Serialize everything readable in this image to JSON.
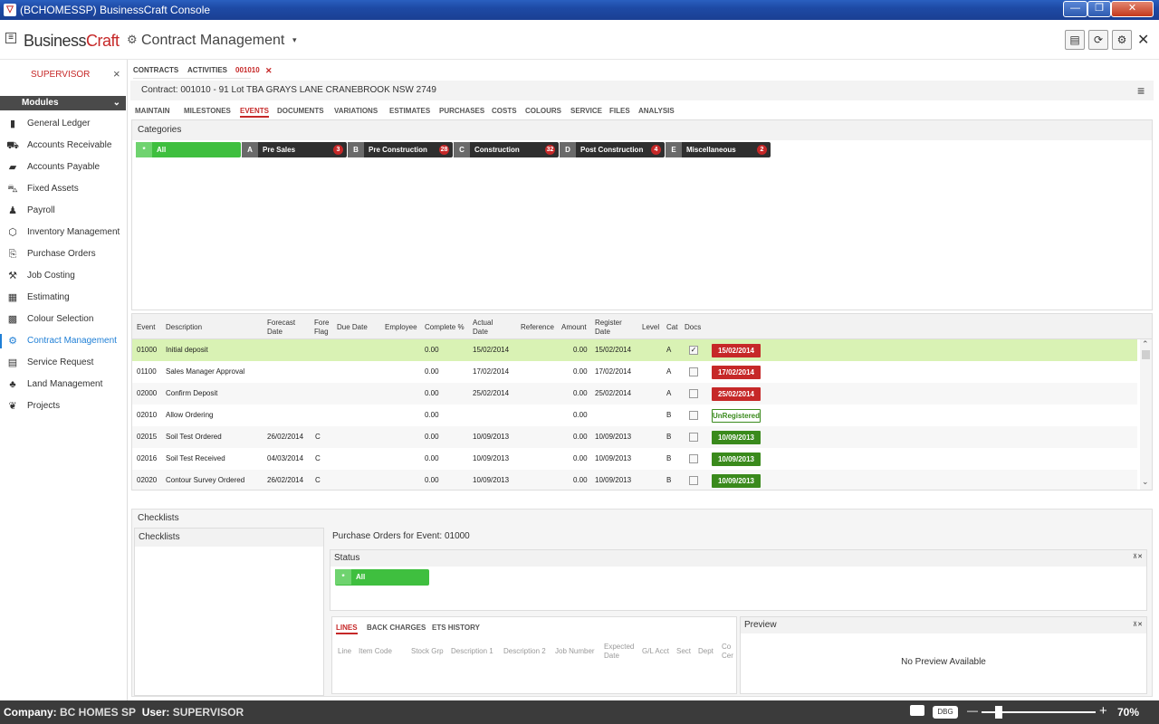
{
  "window": {
    "title": "(BCHOMESSP) BusinessCraft Console",
    "minimize": "—",
    "maximize": "❐",
    "close": "✕"
  },
  "header": {
    "menu_icon": "≡",
    "brand_a": "Business",
    "brand_b": "Craft",
    "title": "Contract Management",
    "close": "✕"
  },
  "sidebar": {
    "user": "SUPERVISOR",
    "close": "×",
    "modules_label": "Modules",
    "items": [
      {
        "label": "General Ledger",
        "icon": "book-icon"
      },
      {
        "label": "Accounts Receivable",
        "icon": "cart-icon"
      },
      {
        "label": "Accounts Payable",
        "icon": "folder-icon"
      },
      {
        "label": "Fixed Assets",
        "icon": "car-icon"
      },
      {
        "label": "Payroll",
        "icon": "people-icon"
      },
      {
        "label": "Inventory Management",
        "icon": "box-icon"
      },
      {
        "label": "Purchase Orders",
        "icon": "purchase-icon"
      },
      {
        "label": "Job Costing",
        "icon": "hammer-icon"
      },
      {
        "label": "Estimating",
        "icon": "calculator-icon"
      },
      {
        "label": "Colour Selection",
        "icon": "grid-icon"
      },
      {
        "label": "Contract Management",
        "icon": "handshake-icon"
      },
      {
        "label": "Service Request",
        "icon": "document-icon"
      },
      {
        "label": "Land Management",
        "icon": "tree-icon"
      },
      {
        "label": "Projects",
        "icon": "projects-icon"
      }
    ]
  },
  "breadcrumb_tabs": {
    "contracts": "CONTRACTS",
    "activities": "ACTIVITIES",
    "current": "001010",
    "close": "✕"
  },
  "contract_title": "Contract: 001010 - 91 Lot TBA GRAYS LANE CRANEBROOK NSW 2749",
  "section_tabs": [
    "MAINTAIN",
    "MILESTONES",
    "EVENTS",
    "DOCUMENTS",
    "VARIATIONS",
    "ESTIMATES",
    "PURCHASES",
    "COSTS",
    "COLOURS",
    "SERVICE",
    "FILES",
    "ANALYSIS"
  ],
  "categories": {
    "label": "Categories",
    "chips": [
      {
        "letter": "*",
        "label": "All",
        "count": ""
      },
      {
        "letter": "A",
        "label": "Pre Sales",
        "count": "3"
      },
      {
        "letter": "B",
        "label": "Pre Construction",
        "count": "28"
      },
      {
        "letter": "C",
        "label": "Construction",
        "count": "32"
      },
      {
        "letter": "D",
        "label": "Post Construction",
        "count": "4"
      },
      {
        "letter": "E",
        "label": "Miscellaneous",
        "count": "2"
      }
    ]
  },
  "grid": {
    "headers": {
      "event": "Event",
      "description": "Description",
      "forecast1": "Forecast",
      "forecast2": "Date",
      "fore1": "Fore",
      "fore2": "Flag",
      "due": "Due Date",
      "employee": "Employee",
      "complete": "Complete %",
      "actual1": "Actual",
      "actual2": "Date",
      "reference": "Reference",
      "amount": "Amount",
      "register1": "Register",
      "register2": "Date",
      "level": "Level",
      "cat": "Cat",
      "docs": "Docs"
    },
    "rows": [
      {
        "event": "01000",
        "desc": "Initial deposit",
        "forecast": "",
        "flag": "",
        "complete": "0.00",
        "actual": "15/02/2014",
        "amount": "0.00",
        "register": "15/02/2014",
        "cat": "A",
        "docs": "✓",
        "status": "15/02/2014",
        "status_type": "red"
      },
      {
        "event": "01100",
        "desc": "Sales Manager Approval",
        "forecast": "",
        "flag": "",
        "complete": "0.00",
        "actual": "17/02/2014",
        "amount": "0.00",
        "register": "17/02/2014",
        "cat": "A",
        "docs": "",
        "status": "17/02/2014",
        "status_type": "red"
      },
      {
        "event": "02000",
        "desc": "Confirm Deposit",
        "forecast": "",
        "flag": "",
        "complete": "0.00",
        "actual": "25/02/2014",
        "amount": "0.00",
        "register": "25/02/2014",
        "cat": "A",
        "docs": "",
        "status": "25/02/2014",
        "status_type": "red"
      },
      {
        "event": "02010",
        "desc": "Allow Ordering",
        "forecast": "",
        "flag": "",
        "complete": "0.00",
        "actual": "",
        "amount": "0.00",
        "register": "",
        "cat": "B",
        "docs": "",
        "status": "UnRegistered",
        "status_type": "outline"
      },
      {
        "event": "02015",
        "desc": "Soil Test Ordered",
        "forecast": "26/02/2014",
        "flag": "C",
        "complete": "0.00",
        "actual": "10/09/2013",
        "amount": "0.00",
        "register": "10/09/2013",
        "cat": "B",
        "docs": "",
        "status": "10/09/2013",
        "status_type": "green"
      },
      {
        "event": "02016",
        "desc": "Soil Test Received",
        "forecast": "04/03/2014",
        "flag": "C",
        "complete": "0.00",
        "actual": "10/09/2013",
        "amount": "0.00",
        "register": "10/09/2013",
        "cat": "B",
        "docs": "",
        "status": "10/09/2013",
        "status_type": "green"
      },
      {
        "event": "02020",
        "desc": "Contour Survey Ordered",
        "forecast": "26/02/2014",
        "flag": "C",
        "complete": "0.00",
        "actual": "10/09/2013",
        "amount": "0.00",
        "register": "10/09/2013",
        "cat": "B",
        "docs": "",
        "status": "10/09/2013",
        "status_type": "green"
      }
    ]
  },
  "checklists": {
    "section_label": "Checklists",
    "panel_label": "Checklists"
  },
  "purchase_orders": {
    "title": "Purchase Orders for Event: 01000",
    "status_label": "Status",
    "status_chip": {
      "letter": "*",
      "label": "All"
    },
    "pin": "⊼✕",
    "tabs": [
      "LINES",
      "BACK CHARGES",
      "ETS HISTORY"
    ],
    "columns": {
      "line": "Line",
      "item_code": "Item Code",
      "stock_grp": "Stock Grp",
      "desc1": "Description 1",
      "desc2": "Description 2",
      "job_number": "Job Number",
      "expected1": "Expected",
      "expected2": "Date",
      "gl_acct": "G/L Acct",
      "sect": "Sect",
      "dept": "Dept",
      "co1": "Co",
      "co2": "Cer"
    }
  },
  "preview": {
    "label": "Preview",
    "empty": "No Preview Available",
    "pin": "⊼✕"
  },
  "statusbar": {
    "company_label": "Company:",
    "company": "BC HOMES SP",
    "user_label": "User:",
    "user": "SUPERVISOR",
    "dbg": "DBG",
    "zoom": "70%",
    "minus": "—",
    "plus": "+"
  },
  "colors": {
    "accent": "#c62828",
    "active_nav": "#1f7fd6",
    "green": "#3a8a1c",
    "highlight_row": "#d9f2b4",
    "all_chip": "#3fbf3f"
  }
}
